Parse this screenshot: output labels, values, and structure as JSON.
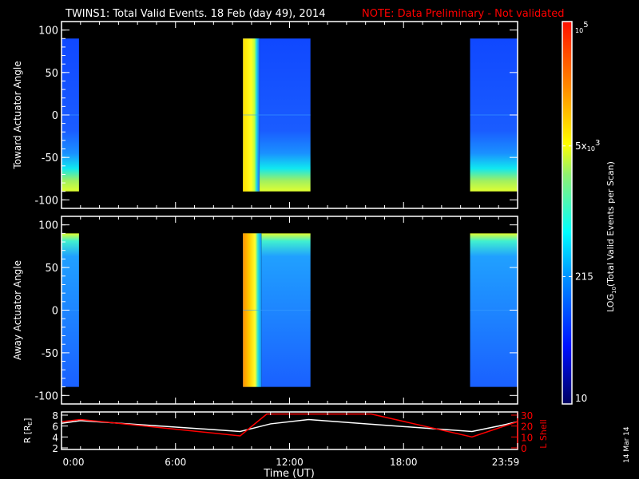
{
  "chart_data": {
    "type": "heatmap",
    "title": "TWINS1: Total Valid Events. 18 Feb (day  49), 2014",
    "note": "NOTE: Data Preliminary - Not validated",
    "xlabel": "Time (UT)",
    "x_ticks": [
      "0:00",
      "6:00",
      "12:00",
      "18:00",
      "23:59"
    ],
    "x_tick_hours": [
      0,
      6,
      12,
      18,
      24
    ],
    "xlim_hours": [
      0,
      24
    ],
    "panels": [
      {
        "ylabel": "Toward Actuator Angle",
        "ylim": [
          -110,
          110
        ],
        "y_ticks": [
          "100",
          "50",
          "0",
          "-50",
          "-100"
        ],
        "y_tick_values": [
          100,
          50,
          0,
          -50,
          -100
        ],
        "angle_range": [
          -90,
          90
        ],
        "data_intervals_hours": [
          [
            0,
            0.92
          ],
          [
            9.55,
            13.1
          ],
          [
            21.5,
            24
          ]
        ],
        "bright_edge": "bottom"
      },
      {
        "ylabel": "Away Actuator Angle",
        "ylim": [
          -110,
          110
        ],
        "y_ticks": [
          "100",
          "50",
          "0",
          "-50",
          "-100"
        ],
        "y_tick_values": [
          100,
          50,
          0,
          -50,
          -100
        ],
        "angle_range": [
          -90,
          90
        ],
        "data_intervals_hours": [
          [
            0,
            0.92
          ],
          [
            9.55,
            13.1
          ],
          [
            21.5,
            24
          ]
        ],
        "bright_edge": "top"
      }
    ],
    "colorbar": {
      "label": "LOG10(Total Valid Events per Scan)",
      "label_main": "LOG",
      "label_sub": "10",
      "label_rest": "(Total Valid Events per Scan)",
      "min": 10,
      "max": 100000,
      "ticks": [
        {
          "value": 100000,
          "base": "10",
          "exp": "5",
          "prefix": ""
        },
        {
          "value": 5000,
          "base": "10",
          "exp": "3",
          "prefix": "5x"
        },
        {
          "value": 215,
          "text": "215"
        },
        {
          "value": 10,
          "text": "10"
        }
      ]
    },
    "orbit_panel": {
      "left_label": "R [R",
      "left_label_sub": "E",
      "left_label_end": "]",
      "right_label": "L Shell",
      "left_ylim": [
        2,
        8
      ],
      "left_ticks": [
        "8",
        "6",
        "4",
        "2"
      ],
      "left_tick_values": [
        8,
        6,
        4,
        2
      ],
      "right_ylim": [
        0,
        30
      ],
      "right_ticks": [
        "30",
        "20",
        "10",
        "0"
      ],
      "right_tick_values": [
        30,
        20,
        10,
        0
      ],
      "series": [
        {
          "name": "R",
          "color": "#ffffff",
          "axis": "left",
          "x": [
            0,
            1,
            9.4,
            11,
            13,
            16,
            21.6,
            23,
            24
          ],
          "y": [
            6.5,
            7.0,
            5.0,
            6.4,
            7.2,
            6.4,
            5.0,
            6.0,
            6.8
          ]
        },
        {
          "name": "L Shell",
          "color": "#ff0000",
          "axis": "right",
          "x": [
            0,
            1,
            9.4,
            10.8,
            16.3,
            21.6,
            24
          ],
          "y": [
            24,
            26,
            11,
            31,
            31,
            10,
            24
          ]
        }
      ]
    },
    "date_stamp": "14 Mar 14",
    "colors": {
      "note": "#ff0000",
      "axis": "#ffffff",
      "lshell": "#ff0000"
    }
  }
}
